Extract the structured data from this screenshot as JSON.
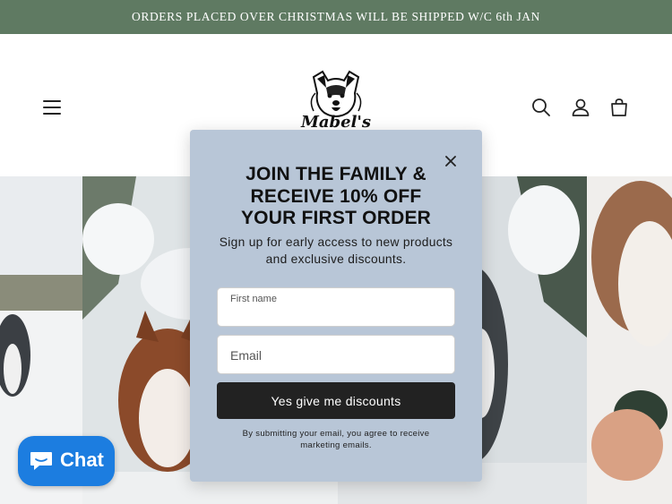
{
  "announcement": {
    "text": "ORDERS PLACED OVER CHRISTMAS WILL BE SHIPPED W/C 6th JAN"
  },
  "header": {
    "logo_text": "Mabel's",
    "menu_icon": "hamburger-menu-icon",
    "search_icon": "search-icon",
    "account_icon": "user-icon",
    "cart_icon": "shopping-bag-icon"
  },
  "popup": {
    "title_lines": [
      "JOIN THE FAMILY &",
      "RECEIVE 10% OFF",
      "YOUR FIRST ORDER"
    ],
    "subtitle_lines": [
      "Sign up for early access to new products",
      "and exclusive discounts."
    ],
    "first_name": {
      "label": "First name",
      "value": ""
    },
    "email": {
      "placeholder": "Email",
      "value": ""
    },
    "cta_label": "Yes give me discounts",
    "disclaimer_lines": [
      "By submitting your email, you agree to receive",
      "marketing emails."
    ],
    "close_icon": "close-icon"
  },
  "chat": {
    "label": "Chat",
    "icon": "chat-bubble-icon"
  },
  "colors": {
    "announcement_bg": "#5f7a62",
    "popup_bg": "#b8c6d7",
    "cta_bg": "#222222",
    "chat_bg": "#1c7de0"
  }
}
